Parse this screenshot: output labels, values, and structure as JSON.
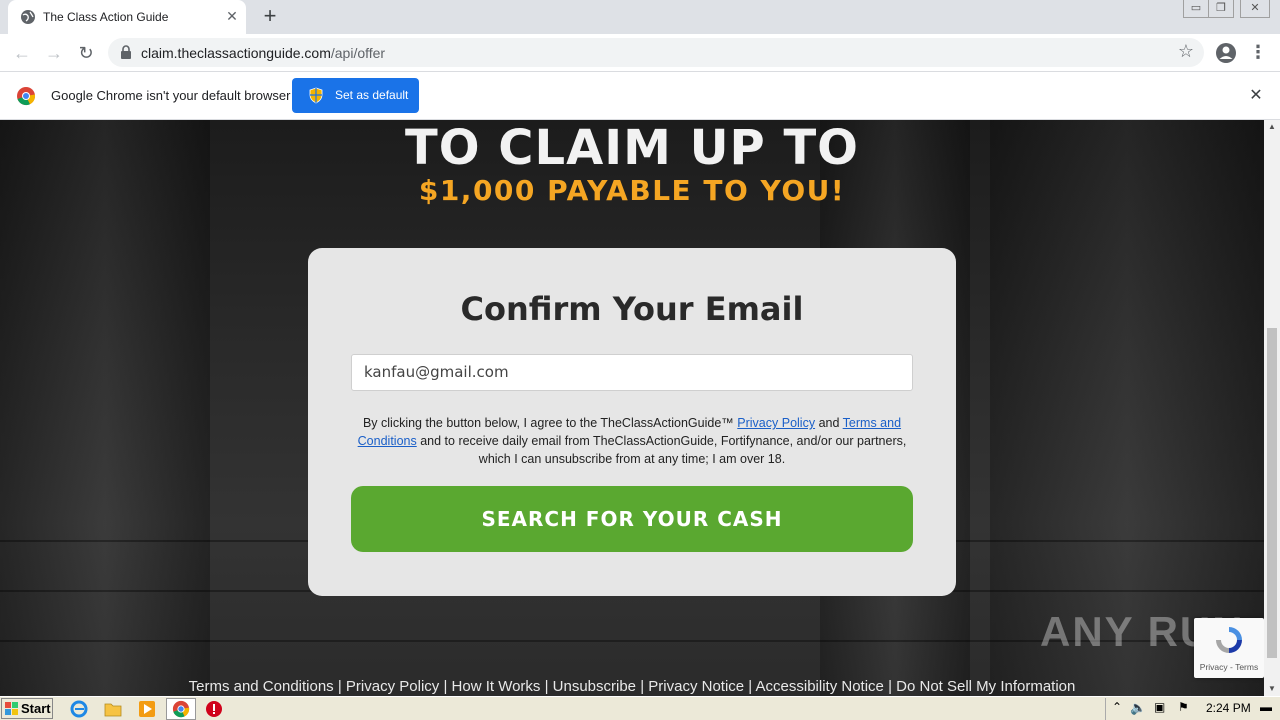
{
  "browser": {
    "tab_title": "The Class Action Guide",
    "tab_close": "✕",
    "new_tab": "+",
    "url_host": "claim.theclassactionguide.com",
    "url_path": "/api/offer",
    "back": "←",
    "forward": "→",
    "reload": "↻",
    "bookmark": "☆",
    "menu": "⋮",
    "window_controls": [
      "▭",
      "❐",
      "✕"
    ]
  },
  "infobar": {
    "message": "Google Chrome isn't your default browser",
    "button_label": "Set as default",
    "close": "✕"
  },
  "page": {
    "headline_line1": "TO CLAIM UP TO",
    "headline_line2": "$1,000 PAYABLE TO YOU!",
    "form_title": "Confirm Your Email",
    "email_value": "kanfau@gmail.com",
    "legal_text_1": "By clicking the button below, I agree to the TheClassActionGuide™",
    "privacy_link": "Privacy Policy",
    "legal_and": "and",
    "terms_link": "Terms and Conditions",
    "legal_text_2": "and to receive daily email from TheClassActionGuide, Fortifynance, and/or our partners, which I can unsubscribe from at any time; I am over 18.",
    "cta_label": "SEARCH FOR YOUR CASH",
    "accent_color": "#f5a623",
    "cta_color": "#5aa830"
  },
  "footer": {
    "links": [
      "Terms and Conditions",
      "Privacy Policy",
      "How It Works",
      "Unsubscribe",
      "Privacy Notice",
      "Accessibility Notice",
      "Do Not Sell My Information"
    ],
    "separator": " | "
  },
  "overlay": {
    "watermark": "ANY RUN",
    "recaptcha_links": "Privacy - Terms"
  },
  "taskbar": {
    "start_label": "Start",
    "clock": "2:24 PM",
    "icons": [
      "ie-icon",
      "folder-icon",
      "media-player-icon",
      "chrome-icon",
      "stop-icon"
    ]
  }
}
